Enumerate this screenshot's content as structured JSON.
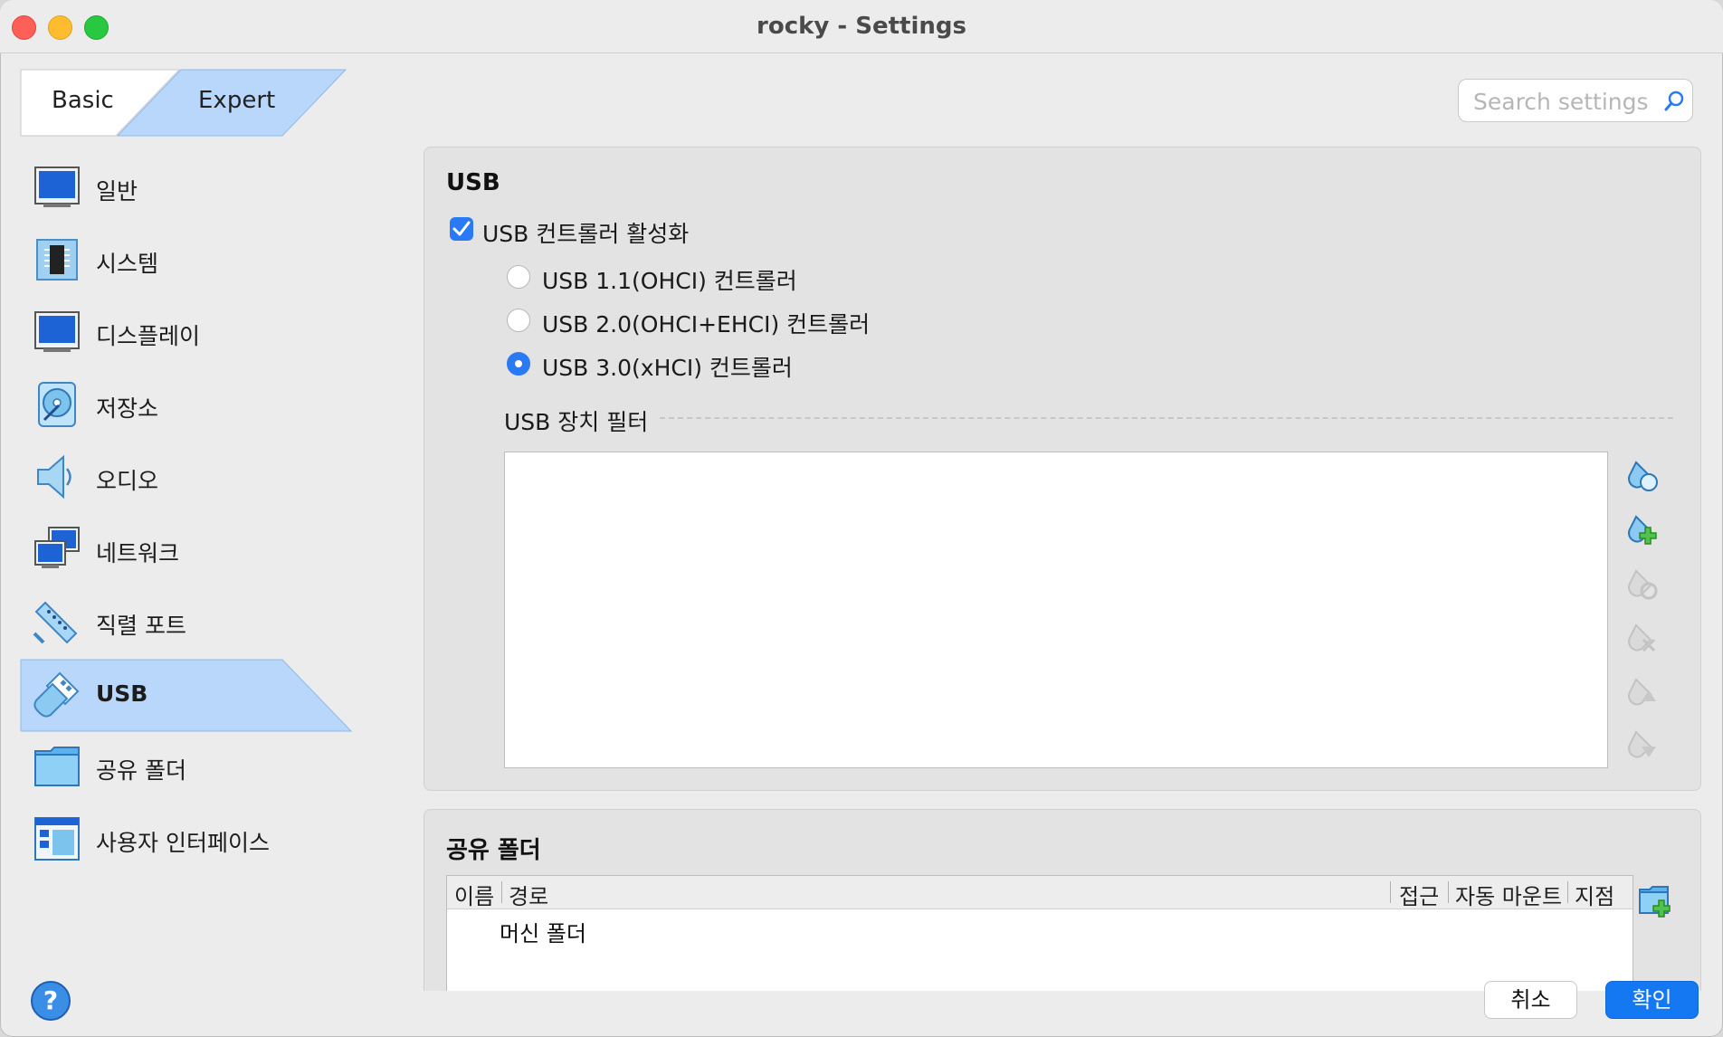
{
  "window": {
    "title": "rocky - Settings"
  },
  "mode": {
    "basic_label": "Basic",
    "expert_label": "Expert",
    "selected": "Expert"
  },
  "search": {
    "placeholder": "Search settings"
  },
  "sidebar": {
    "items": [
      {
        "label": "일반",
        "icon": "general-monitor-icon"
      },
      {
        "label": "시스템",
        "icon": "chip-icon"
      },
      {
        "label": "디스플레이",
        "icon": "display-monitor-icon"
      },
      {
        "label": "저장소",
        "icon": "disk-icon"
      },
      {
        "label": "오디오",
        "icon": "speaker-icon"
      },
      {
        "label": "네트워크",
        "icon": "network-icon"
      },
      {
        "label": "직렬 포트",
        "icon": "serial-port-icon"
      },
      {
        "label": "USB",
        "icon": "usb-icon",
        "active": true
      },
      {
        "label": "공유 폴더",
        "icon": "folder-icon"
      },
      {
        "label": "사용자 인터페이스",
        "icon": "window-layout-icon"
      }
    ]
  },
  "usb": {
    "title": "USB",
    "enable_label": "USB 컨트롤러 활성화",
    "enable_checked": true,
    "controllers": [
      {
        "label": "USB 1.1(OHCI) 컨트롤러",
        "selected": false
      },
      {
        "label": "USB 2.0(OHCI+EHCI) 컨트롤러",
        "selected": false
      },
      {
        "label": "USB 3.0(xHCI) 컨트롤러",
        "selected": true
      }
    ],
    "filters_label": "USB 장치 필터",
    "filter_tools": [
      "add-empty-filter-icon",
      "add-device-filter-icon",
      "edit-filter-icon",
      "remove-filter-icon",
      "move-up-icon",
      "move-down-icon"
    ]
  },
  "shared_folders": {
    "title": "공유 폴더",
    "columns": [
      "이름",
      "경로",
      "접근",
      "자동 마운트",
      "지점"
    ],
    "rows": [
      "머신 폴더"
    ]
  },
  "footer": {
    "help": "?",
    "cancel": "취소",
    "ok": "확인"
  },
  "colors": {
    "accent": "#1478f2",
    "selection": "#b9d7fb"
  }
}
